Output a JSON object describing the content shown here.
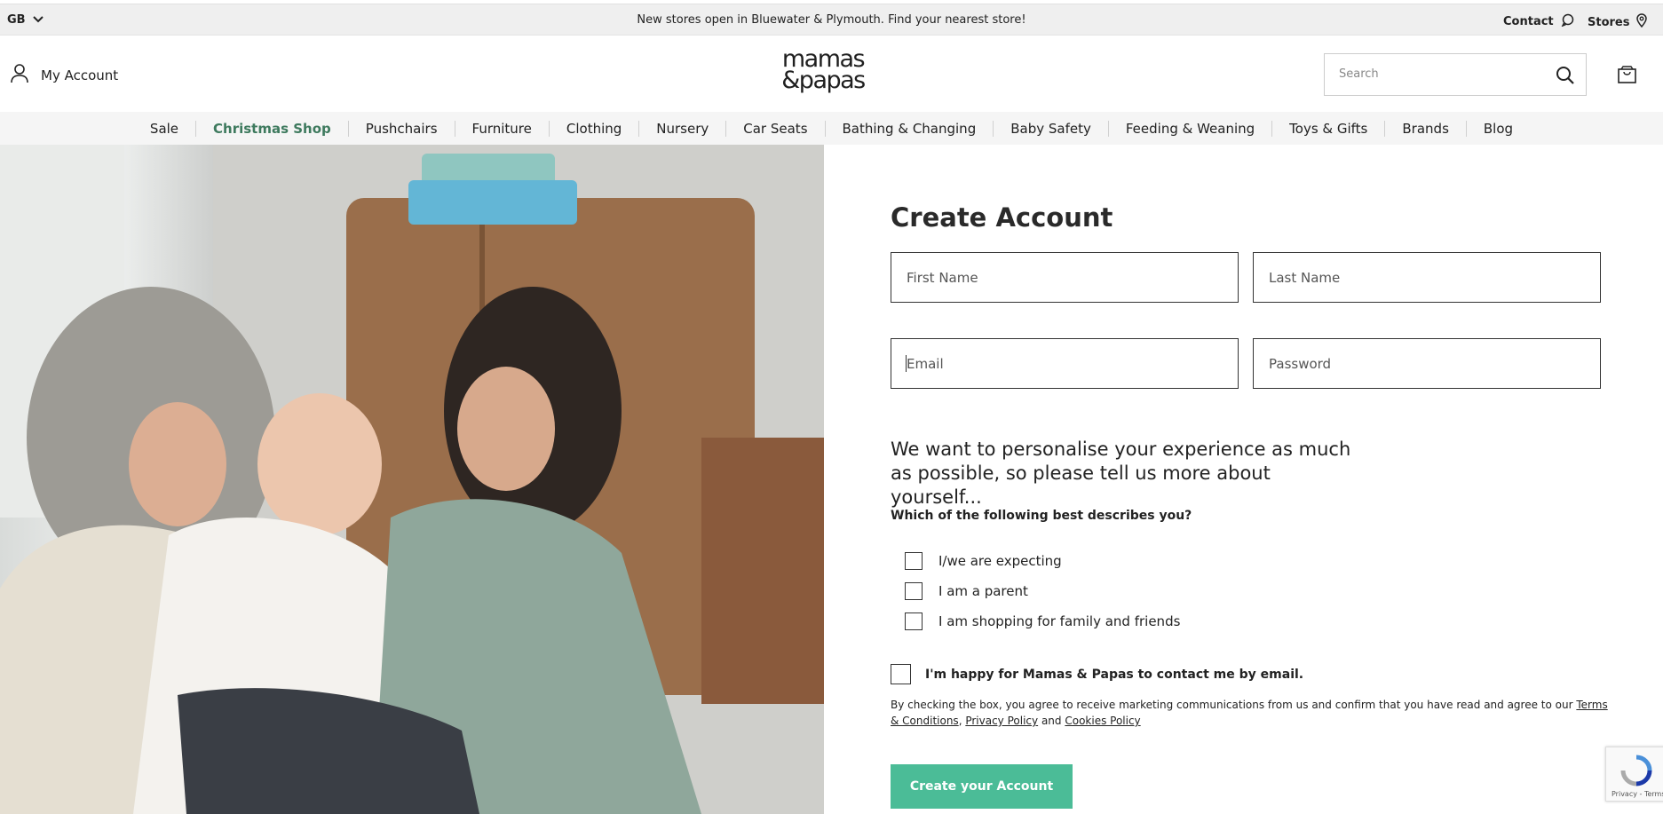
{
  "topbar": {
    "country": "GB",
    "promo": "New stores open in Bluewater & Plymouth. Find your nearest store!",
    "contact": "Contact",
    "stores": "Stores"
  },
  "header": {
    "account_label": "My Account",
    "logo_line1": "mamas",
    "logo_line2": "&papas",
    "search_placeholder": "Search"
  },
  "nav": {
    "items": [
      "Sale",
      "Christmas Shop",
      "Pushchairs",
      "Furniture",
      "Clothing",
      "Nursery",
      "Car Seats",
      "Bathing & Changing",
      "Baby Safety",
      "Feeding & Weaning",
      "Toys & Gifts",
      "Brands",
      "Blog"
    ],
    "highlight_color": "#3e7a5e"
  },
  "form": {
    "title": "Create Account",
    "first_name_placeholder": "First Name",
    "last_name_placeholder": "Last Name",
    "email_placeholder": "Email",
    "password_placeholder": "Password",
    "intro_line1": "We want to personalise your experience as much",
    "intro_line2": "as possible, so please tell us more about yourself...",
    "question": "Which of the following best describes you?",
    "options": [
      "I/we are expecting",
      "I am a parent",
      "I am shopping for family and friends"
    ],
    "consent_label": "I'm happy for Mamas & Papas to contact me by email.",
    "legal_text": "By checking the box, you agree to receive marketing communications from us and confirm that you have read and agree to our",
    "terms_link": "Terms & Conditions",
    "privacy_link": "Privacy Policy",
    "and_text": "and",
    "cookies_link": "Cookies Policy",
    "submit_label": "Create your Account",
    "submit_color": "#4bbc97"
  },
  "recaptcha": {
    "label": "Privacy - Terms"
  }
}
